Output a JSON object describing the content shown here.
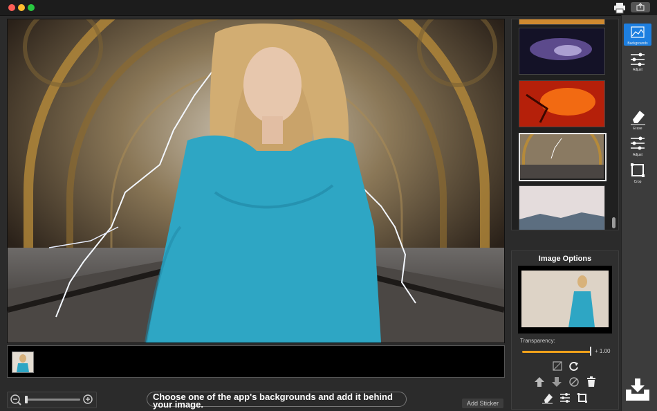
{
  "toolbar_right": {
    "items": [
      {
        "id": "backgrounds",
        "label": "Backgrounds",
        "icon": "backgrounds-icon",
        "active": true
      },
      {
        "id": "adjust-bg",
        "label": "Adjust",
        "icon": "sliders-icon",
        "active": false
      },
      {
        "id": "erase",
        "label": "Erase",
        "icon": "eraser-icon",
        "active": false
      },
      {
        "id": "adjust",
        "label": "Adjust",
        "icon": "sliders-icon",
        "active": false
      },
      {
        "id": "crop",
        "label": "Crop",
        "icon": "crop-icon",
        "active": false
      }
    ]
  },
  "image_options": {
    "title": "Image Options",
    "transparency_label": "Transparency:",
    "transparency_value": "+ 1.00",
    "transparency_level": 1.0
  },
  "bottom": {
    "caption": "Choose one of the app's backgrounds and add it behind your image.",
    "add_sticker": "Add Sticker"
  },
  "colors": {
    "accent": "#1d7fe0",
    "slider": "#f1a21a"
  }
}
